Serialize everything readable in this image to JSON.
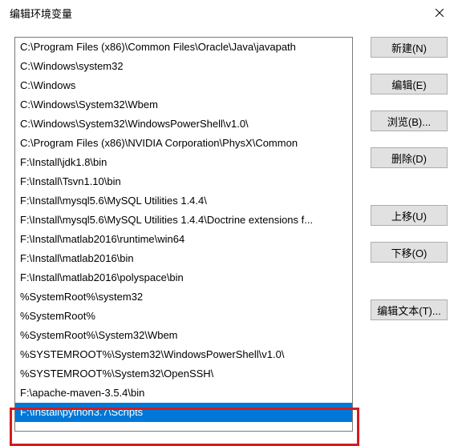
{
  "window": {
    "title": "编辑环境变量"
  },
  "list": {
    "items": [
      "C:\\Program Files (x86)\\Common Files\\Oracle\\Java\\javapath",
      "C:\\Windows\\system32",
      "C:\\Windows",
      "C:\\Windows\\System32\\Wbem",
      "C:\\Windows\\System32\\WindowsPowerShell\\v1.0\\",
      "C:\\Program Files (x86)\\NVIDIA Corporation\\PhysX\\Common",
      "F:\\Install\\jdk1.8\\bin",
      "F:\\Install\\Tsvn1.10\\bin",
      "F:\\Install\\mysql5.6\\MySQL Utilities 1.4.4\\",
      "F:\\Install\\mysql5.6\\MySQL Utilities 1.4.4\\Doctrine extensions f...",
      "F:\\Install\\matlab2016\\runtime\\win64",
      "F:\\Install\\matlab2016\\bin",
      "F:\\Install\\matlab2016\\polyspace\\bin",
      "%SystemRoot%\\system32",
      "%SystemRoot%",
      "%SystemRoot%\\System32\\Wbem",
      "%SYSTEMROOT%\\System32\\WindowsPowerShell\\v1.0\\",
      "%SYSTEMROOT%\\System32\\OpenSSH\\",
      "F:\\apache-maven-3.5.4\\bin",
      "F:\\Install\\python3.7\\Scripts"
    ],
    "selectedIndex": 19
  },
  "buttons": {
    "new": "新建(N)",
    "edit": "编辑(E)",
    "browse": "浏览(B)...",
    "delete": "删除(D)",
    "moveUp": "上移(U)",
    "moveDown": "下移(O)",
    "editText": "编辑文本(T)..."
  }
}
